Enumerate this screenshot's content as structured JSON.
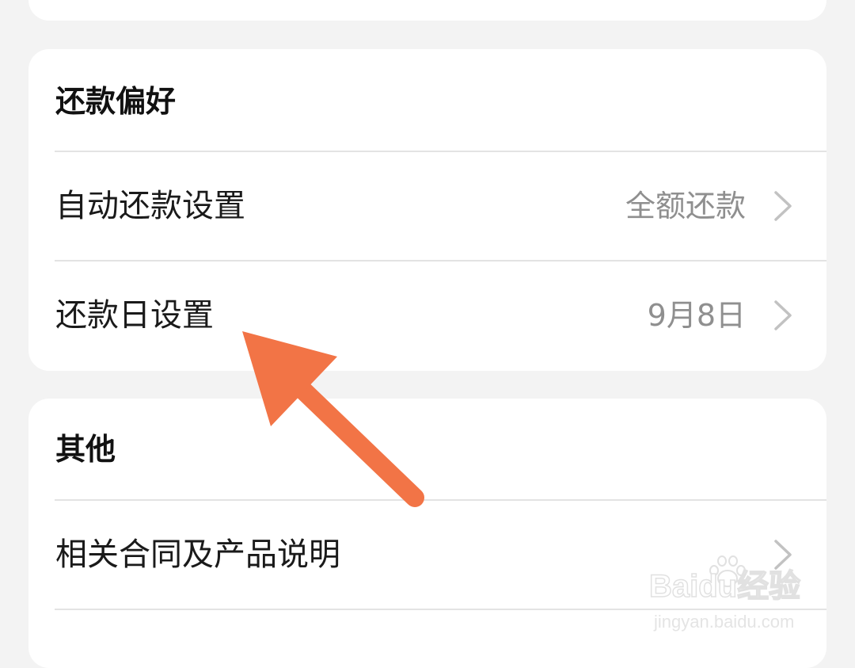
{
  "sections": [
    {
      "title": "还款偏好",
      "items": [
        {
          "label": "自动还款设置",
          "value": "全额还款"
        },
        {
          "label": "还款日设置",
          "value": "9月8日"
        }
      ]
    },
    {
      "title": "其他",
      "items": [
        {
          "label": "相关合同及产品说明",
          "value": ""
        }
      ]
    }
  ],
  "watermark": {
    "brand": "Baidu经验",
    "url": "jingyan.baidu.com"
  },
  "colors": {
    "background": "#f3f3f3",
    "card": "#ffffff",
    "annotation_arrow": "#f27446",
    "value_text": "#8f8f8f",
    "chevron": "#c2c2c2"
  },
  "icons": {
    "row_chevron": "chevron-right-icon",
    "annotation": "arrow-annotation-icon",
    "watermark_logo": "paw-logo-icon"
  }
}
